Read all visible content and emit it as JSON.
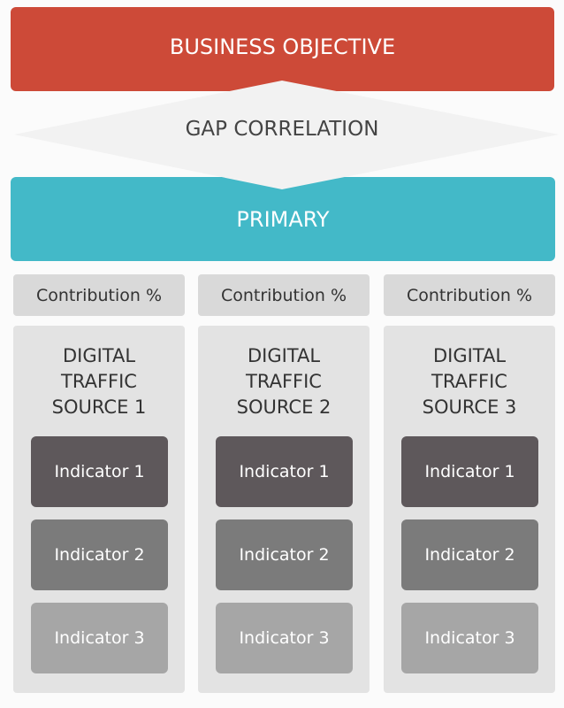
{
  "objective": {
    "label": "BUSINESS OBJECTIVE",
    "color": "#cd4a38"
  },
  "gap": {
    "label": "GAP CORRELATION",
    "color": "#f2f2f2"
  },
  "primary": {
    "label": "PRIMARY",
    "color": "#43b9c8"
  },
  "columns": [
    {
      "contribution": "Contribution %",
      "title": [
        "DIGITAL",
        "TRAFFIC",
        "SOURCE 1"
      ],
      "indicators": [
        "Indicator 1",
        "Indicator 2",
        "Indicator 3"
      ]
    },
    {
      "contribution": "Contribution %",
      "title": [
        "DIGITAL",
        "TRAFFIC",
        "SOURCE 2"
      ],
      "indicators": [
        "Indicator 1",
        "Indicator 2",
        "Indicator 3"
      ]
    },
    {
      "contribution": "Contribution %",
      "title": [
        "DIGITAL",
        "TRAFFIC",
        "SOURCE 3"
      ],
      "indicators": [
        "Indicator 1",
        "Indicator 2",
        "Indicator 3"
      ]
    }
  ],
  "indicator_colors": [
    "#5e585b",
    "#7b7b7b",
    "#a6a6a6"
  ]
}
